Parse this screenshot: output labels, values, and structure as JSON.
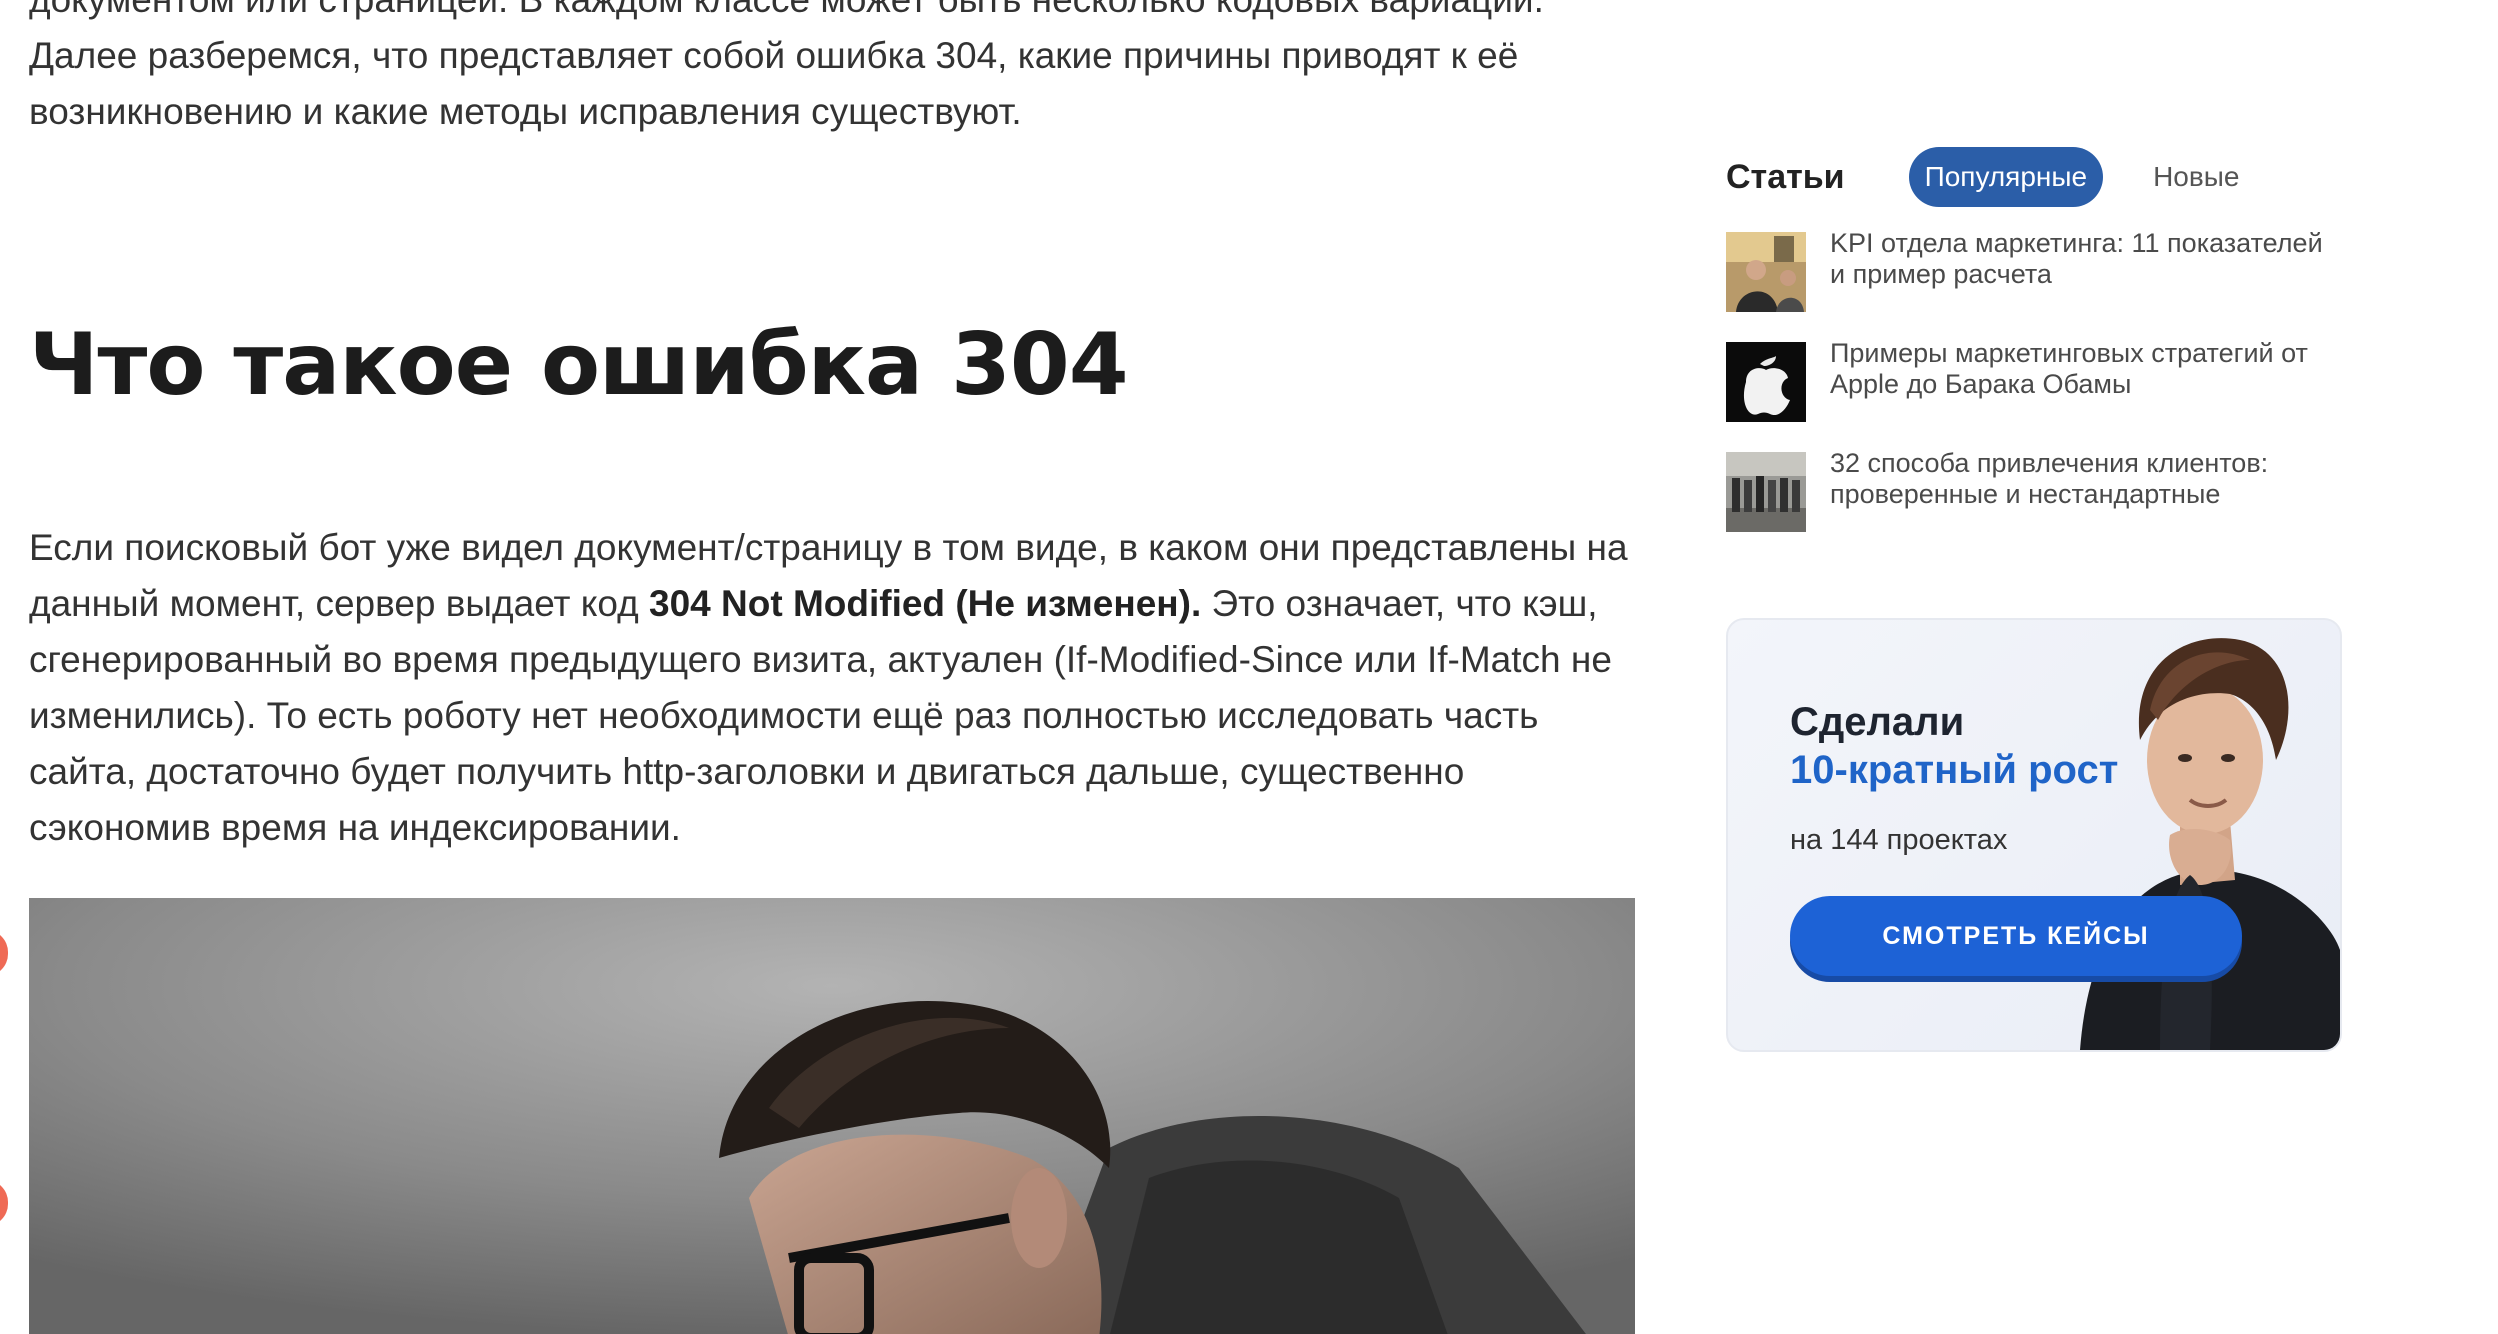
{
  "article": {
    "intro_line1": "документом или страницей. В каждом классе может быть несколько кодовых вариации.",
    "intro_line2": "Далее разберемся, что представляет собой ошибка 304, какие причины приводят к её",
    "intro_line3": "возникновению и какие методы исправления существуют.",
    "section_title": "Что такое ошибка 304",
    "body_part1": "Если поисковый бот уже видел документ/страницу в том виде, в каком они представлены на данный момент, сервер выдает код ",
    "body_bold": "304 Not Modified (Не изменен).",
    "body_part2": " Это означает, что кэш, сгенерированный во время предыдущего визита, актуален (If-Modified-Since или If-Match не изменились). То есть роботу нет необходимости ещё раз полностью исследовать часть сайта, достаточно будет получить http-заголовки и двигаться дальше, существенно сэкономив время на индексировании."
  },
  "sidebar": {
    "heading": "Статьи",
    "tab_popular": "Популярные",
    "tab_new": "Новые",
    "articles": [
      {
        "title": "KPI отдела маркетинга: 11 показателей и пример расчета",
        "thumb": "photo-people-icon"
      },
      {
        "title": "Примеры маркетинговых стратегий от Apple до Барака Обамы",
        "thumb": "apple-logo-icon"
      },
      {
        "title": "32 способа привлечения клиентов: проверенные и нестандартные",
        "thumb": "photo-crowd-icon"
      }
    ]
  },
  "ad": {
    "line1": "Сделали",
    "line2": "10-кратный рост",
    "line3": "на 144 проектах",
    "button": "СМОТРЕТЬ КЕЙСЫ",
    "accent_color": "#1d62d6"
  }
}
